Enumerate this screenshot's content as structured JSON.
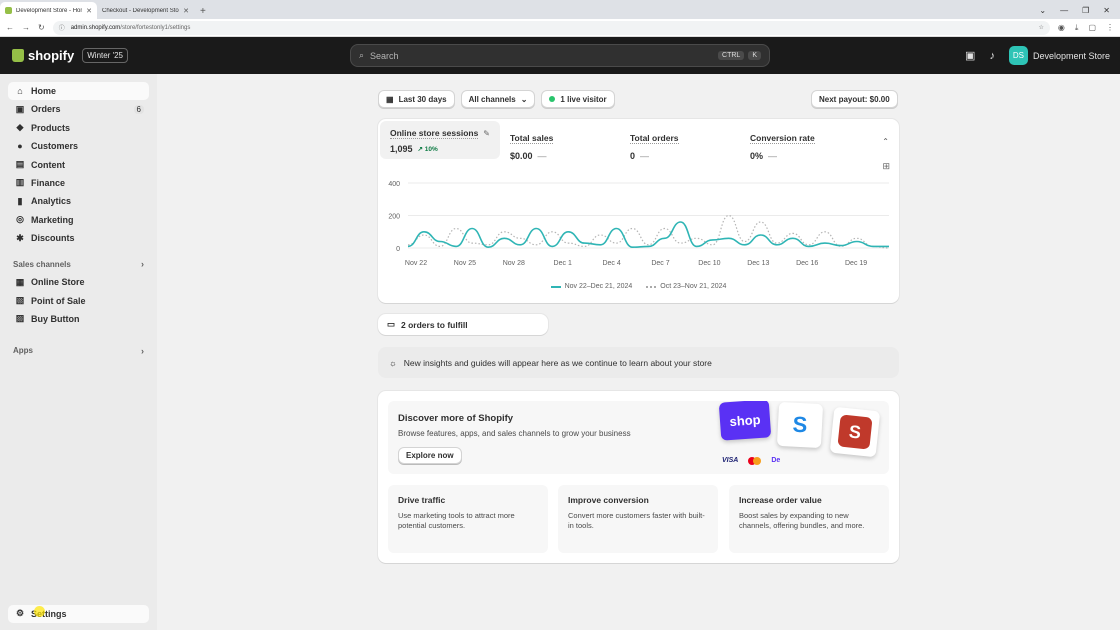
{
  "browser": {
    "tabs": [
      {
        "title": "Development Store - Home - Sh",
        "active": true
      },
      {
        "title": "Checkout - Development Store",
        "active": false
      }
    ],
    "url_host": "admin.shopify.com",
    "url_path": "/store/fortestonly1/settings"
  },
  "topbar": {
    "logo_text": "shopify",
    "edition": "Winter '25",
    "search_placeholder": "Search",
    "shortcut_ctrl": "CTRL",
    "shortcut_key": "K",
    "avatar_initials": "DS",
    "store_name": "Development Store"
  },
  "sidebar": {
    "items": [
      {
        "label": "Home",
        "icon": "home-icon",
        "glyph": "⌂",
        "active": true
      },
      {
        "label": "Orders",
        "icon": "orders-icon",
        "glyph": "▣",
        "count": "6"
      },
      {
        "label": "Products",
        "icon": "tag-icon",
        "glyph": "◆"
      },
      {
        "label": "Customers",
        "icon": "person-icon",
        "glyph": "●"
      },
      {
        "label": "Content",
        "icon": "content-icon",
        "glyph": "▤"
      },
      {
        "label": "Finance",
        "icon": "bank-icon",
        "glyph": "▥"
      },
      {
        "label": "Analytics",
        "icon": "bar-chart-icon",
        "glyph": "▮"
      },
      {
        "label": "Marketing",
        "icon": "target-icon",
        "glyph": "◎"
      },
      {
        "label": "Discounts",
        "icon": "discount-icon",
        "glyph": "✱"
      }
    ],
    "sales_channels_label": "Sales channels",
    "channels": [
      {
        "label": "Online Store",
        "icon": "store-icon",
        "glyph": "▦"
      },
      {
        "label": "Point of Sale",
        "icon": "pos-icon",
        "glyph": "▧"
      },
      {
        "label": "Buy Button",
        "icon": "buy-button-icon",
        "glyph": "▨"
      }
    ],
    "apps_label": "Apps",
    "settings_label": "Settings"
  },
  "filters": {
    "date_range": "Last 30 days",
    "channels": "All channels",
    "live_visitors": "1 live visitor",
    "payout": "Next payout: $0.00"
  },
  "metrics": [
    {
      "title": "Online store sessions",
      "value": "1,095",
      "trend": "10%"
    },
    {
      "title": "Total sales",
      "value": "$0.00"
    },
    {
      "title": "Total orders",
      "value": "0"
    },
    {
      "title": "Conversion rate",
      "value": "0%"
    }
  ],
  "chart_data": {
    "type": "line",
    "x_ticks": [
      "Nov 22",
      "Nov 25",
      "Nov 28",
      "Dec 1",
      "Dec 4",
      "Dec 7",
      "Dec 10",
      "Dec 13",
      "Dec 16",
      "Dec 19"
    ],
    "ylim": [
      0,
      400
    ],
    "y_ticks": [
      0,
      200,
      400
    ],
    "grid": true,
    "series": [
      {
        "name": "Nov 22–Dec 21, 2024",
        "style": "solid",
        "color": "#2fb5b5",
        "values": [
          10,
          100,
          40,
          10,
          120,
          5,
          60,
          20,
          120,
          10,
          100,
          30,
          20,
          120,
          5,
          10,
          60,
          160,
          10,
          50,
          60,
          20,
          80,
          20,
          60,
          10,
          30,
          15,
          40,
          10,
          10
        ]
      },
      {
        "name": "Oct 23–Nov 21, 2024",
        "style": "dotted",
        "color": "#b5b5b5",
        "values": [
          20,
          80,
          10,
          120,
          30,
          20,
          100,
          60,
          20,
          100,
          30,
          10,
          80,
          30,
          120,
          20,
          120,
          30,
          60,
          20,
          200,
          40,
          160,
          30,
          90,
          20,
          100,
          10,
          60,
          10,
          0
        ]
      }
    ]
  },
  "fulfill": {
    "label": "2 orders to fulfill"
  },
  "insights": {
    "text": "New insights and guides will appear here as we continue to learn about your store"
  },
  "discover": {
    "title": "Discover more of Shopify",
    "subtitle": "Browse features, apps, and sales channels to grow your business",
    "button": "Explore now",
    "tile_shop": "shop",
    "tile_s": "S",
    "tile_red": "S",
    "pay_visa": "VISA",
    "pay_other": "De"
  },
  "tips": [
    {
      "title": "Drive traffic",
      "desc": "Use marketing tools to attract more potential customers."
    },
    {
      "title": "Improve conversion",
      "desc": "Convert more customers faster with built-in tools."
    },
    {
      "title": "Increase order value",
      "desc": "Boost sales by expanding to new channels, offering bundles, and more."
    }
  ],
  "colors": {
    "accent": "#2fb5b5",
    "brand": "#95bf47",
    "topbar": "#1a1a1a"
  }
}
